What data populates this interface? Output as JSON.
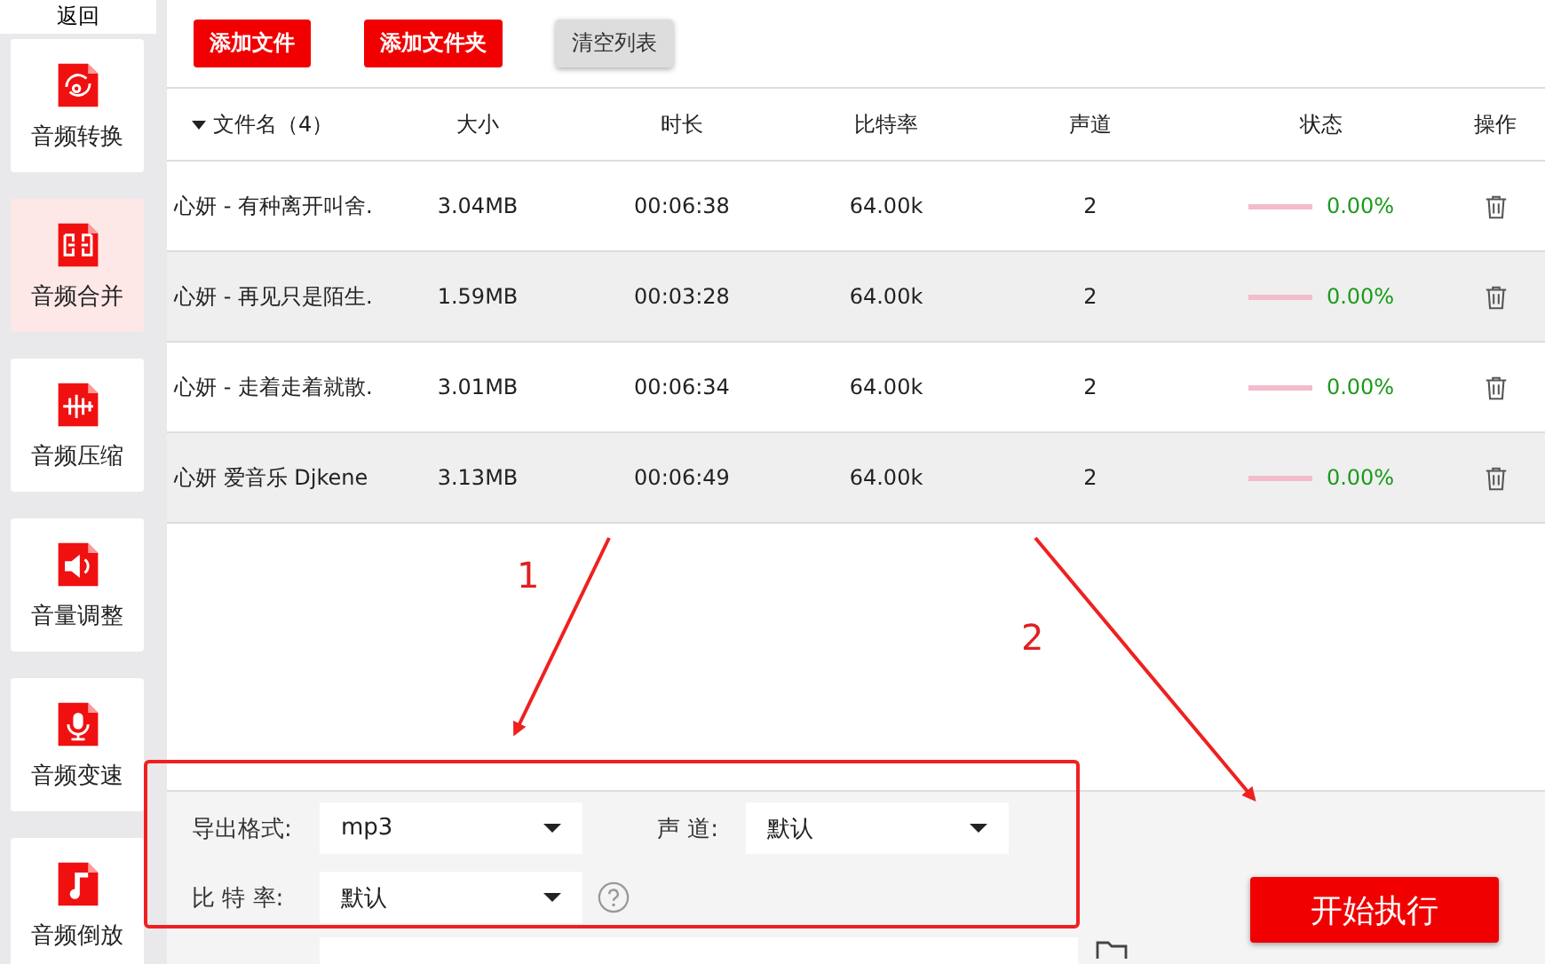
{
  "sidebar": {
    "back": "返回",
    "items": [
      {
        "label": "音频转换",
        "kind": "convert",
        "selected": false
      },
      {
        "label": "音频合并",
        "kind": "merge",
        "selected": true
      },
      {
        "label": "音频压缩",
        "kind": "compress",
        "selected": false
      },
      {
        "label": "音量调整",
        "kind": "volume",
        "selected": false
      },
      {
        "label": "音频变速",
        "kind": "mic",
        "selected": false
      },
      {
        "label": "音频倒放",
        "kind": "note",
        "selected": false
      }
    ]
  },
  "toolbar": [
    {
      "label": "添加文件",
      "kind": "primary"
    },
    {
      "label": "添加文件夹",
      "kind": "primary"
    },
    {
      "label": "清空列表",
      "kind": "secondary"
    }
  ],
  "table": {
    "columns": [
      "文件名（4）",
      "大小",
      "时长",
      "比特率",
      "声道",
      "状态",
      "操作"
    ],
    "rows": [
      {
        "name": "心妍 - 有种离开叫舍.",
        "size": "3.04MB",
        "duration": "00:06:38",
        "bitrate": "64.00k",
        "channels": "2",
        "level": 0,
        "status": "0.00%"
      },
      {
        "name": "心妍 - 再见只是陌生.",
        "size": "1.59MB",
        "duration": "00:03:28",
        "bitrate": "64.00k",
        "channels": "2",
        "level": 0,
        "status": "0.00%"
      },
      {
        "name": "心妍 - 走着走着就散.",
        "size": "3.01MB",
        "duration": "00:06:34",
        "bitrate": "64.00k",
        "channels": "2",
        "level": 0,
        "status": "0.00%"
      },
      {
        "name": "心妍 爱音乐 Djkene",
        "size": "3.13MB",
        "duration": "00:06:49",
        "bitrate": "64.00k",
        "channels": "2",
        "level": 0,
        "status": "0.00%"
      }
    ]
  },
  "settings": {
    "format_label": "导出格式:",
    "format_value": "mp3",
    "channel_label": "声 道:",
    "channel_value": "默认",
    "bitrate_label": "比 特 率:",
    "bitrate_value": "默认",
    "start_button": "开始执行"
  },
  "annotations": [
    {
      "label": "1"
    },
    {
      "label": "2"
    }
  ]
}
